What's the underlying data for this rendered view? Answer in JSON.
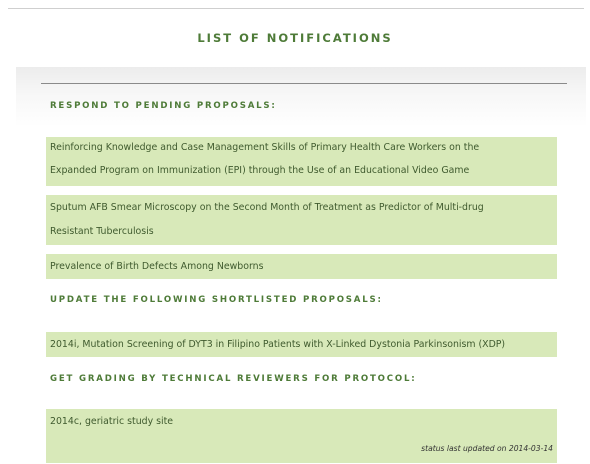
{
  "header": {
    "title": "LIST OF NOTIFICATIONS"
  },
  "sections": [
    {
      "label": "RESPOND TO PENDING PROPOSALS:",
      "items": [
        {
          "lines": [
            "Reinforcing Knowledge and Case Management Skills of Primary Health Care Workers on the",
            "Expanded Program on Immunization (EPI) through the Use of an Educational Video Game"
          ]
        },
        {
          "lines": [
            "Sputum AFB Smear Microscopy on the Second Month of Treatment as Predictor of Multi-drug",
            "Resistant Tuberculosis"
          ]
        },
        {
          "lines": [
            "Prevalence of Birth Defects Among Newborns"
          ]
        }
      ]
    },
    {
      "label": "UPDATE THE FOLLOWING SHORTLISTED PROPOSALS:",
      "items": [
        {
          "lines": [
            "2014i, Mutation Screening of DYT3 in Filipino Patients with X-Linked Dystonia Parkinsonism (XDP)"
          ]
        }
      ]
    },
    {
      "label": "GET GRADING BY TECHNICAL REVIEWERS FOR PROTOCOL:",
      "items": [
        {
          "lines": [
            "2014c, geriatric study site"
          ]
        }
      ]
    }
  ],
  "status": "status last updated on 2014-03-14"
}
